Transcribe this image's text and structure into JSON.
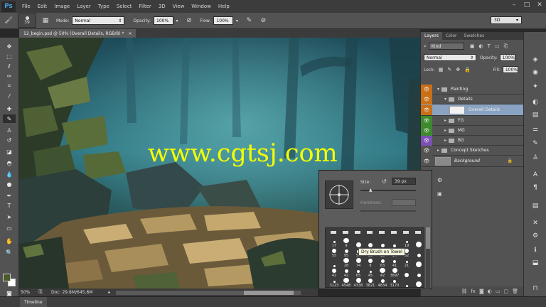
{
  "app": {
    "logo": "Ps"
  },
  "menu": [
    "File",
    "Edit",
    "Image",
    "Layer",
    "Type",
    "Select",
    "Filter",
    "3D",
    "View",
    "Window",
    "Help"
  ],
  "window_controls": [
    "–",
    "□",
    "✕"
  ],
  "options": {
    "brush_size": "39",
    "mode_label": "Mode:",
    "mode_value": "Normal",
    "opacity_label": "Opacity:",
    "opacity_value": "100%",
    "flow_label": "Flow:",
    "flow_value": "100%",
    "workspace": "3D"
  },
  "document": {
    "tab_title": "12_begin.psd @ 50% (Overall Details, RGB/8) *",
    "close": "×"
  },
  "status": {
    "zoom": "50%",
    "doc_info": "Doc: 29.8M/645.8M"
  },
  "timeline": {
    "label": "Timeline"
  },
  "watermark": "www.cgtsj.com",
  "layers_panel": {
    "tabs": [
      "Layers",
      "Color",
      "Swatches"
    ],
    "filter_kind": "Kind",
    "blend_mode": "Normal",
    "opacity_label": "Opacity:",
    "opacity_value": "100%",
    "lock_label": "Lock:",
    "fill_label": "Fill:",
    "fill_value": "100%",
    "layers": [
      {
        "name": "Painting",
        "type": "group",
        "depth": 0,
        "color": "#535353"
      },
      {
        "name": "Details",
        "type": "group",
        "depth": 1,
        "color": "#535353"
      },
      {
        "name": "Overall Details",
        "type": "layer",
        "depth": 2,
        "color": "#8aa3c2",
        "selected": true
      },
      {
        "name": "FG",
        "type": "group",
        "depth": 1,
        "color": "#535353"
      },
      {
        "name": "MG",
        "type": "group",
        "depth": 1,
        "color": "#535353"
      },
      {
        "name": "BG",
        "type": "group",
        "depth": 1,
        "color": "#535353"
      },
      {
        "name": "Concept Sketches",
        "type": "group",
        "depth": 0,
        "color": "#535353"
      },
      {
        "name": "Background",
        "type": "background",
        "depth": 0,
        "color": "#535353"
      }
    ],
    "eye_colors": [
      "#c96f16",
      "#c96f16",
      "#c96f16",
      "#3d8a2d",
      "#3d8a2d",
      "#7b4fb5",
      "#535353",
      "#535353"
    ]
  },
  "brush_picker": {
    "size_label": "Size:",
    "size_value": "39 px",
    "hardness_label": "Hardness:",
    "tooltip": "Dry Brush on Towel",
    "row_labels": [
      [
        "17",
        "9",
        "",
        "",
        "",
        "",
        "19",
        ""
      ],
      [
        "55",
        "95",
        "54",
        "39",
        "13",
        "14",
        "52",
        ""
      ],
      [
        "",
        "28",
        "74",
        "8",
        "63",
        "41",
        "21",
        ""
      ],
      [
        "42",
        "42",
        "65",
        "45",
        "42",
        "3897",
        "",
        ""
      ],
      [
        "3123",
        "4548",
        "4338",
        "3821",
        "4834",
        "3170",
        "",
        ""
      ]
    ]
  }
}
